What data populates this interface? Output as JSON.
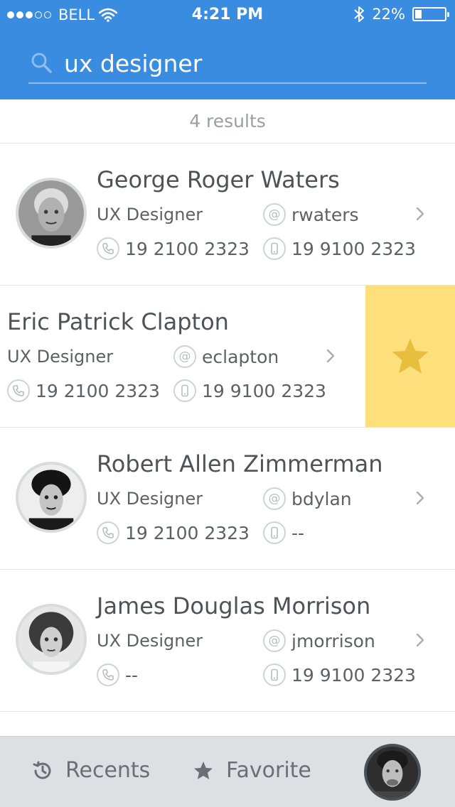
{
  "status_bar": {
    "carrier": "BELL",
    "time": "4:21 PM",
    "battery": "22%",
    "battery_level": 0.22,
    "signal_dots_on": 3,
    "signal_dots_total": 5
  },
  "search": {
    "query": "ux designer",
    "icon": "search-icon"
  },
  "results": {
    "count_label": "4 results"
  },
  "contacts": [
    {
      "name": "George Roger Waters",
      "role": "UX Designer",
      "username": "rwaters",
      "phone": "19 2100 2323",
      "mobile": "19 9100 2323",
      "swiped": false
    },
    {
      "name": "Eric Patrick Clapton",
      "role": "UX Designer",
      "username": "eclapton",
      "phone": "19 2100 2323",
      "mobile": "19 9100 2323",
      "swiped": true
    },
    {
      "name": "Robert Allen Zimmerman",
      "role": "UX Designer",
      "username": "bdylan",
      "phone": "19 2100 2323",
      "mobile": "--",
      "swiped": false
    },
    {
      "name": "James Douglas Morrison",
      "role": "UX Designer",
      "username": "jmorrison",
      "phone": "--",
      "mobile": "19 9100 2323",
      "swiped": false
    }
  ],
  "swipe_action": {
    "icon": "star-icon",
    "color": "#fddf7c",
    "icon_color": "#e8be3e"
  },
  "tabbar": {
    "recents_label": "Recents",
    "favorite_label": "Favorite"
  },
  "colors": {
    "header": "#3a8ce0",
    "text": "#555a5f",
    "muted": "#9a9ea2",
    "tabbar": "#dde0e3"
  }
}
